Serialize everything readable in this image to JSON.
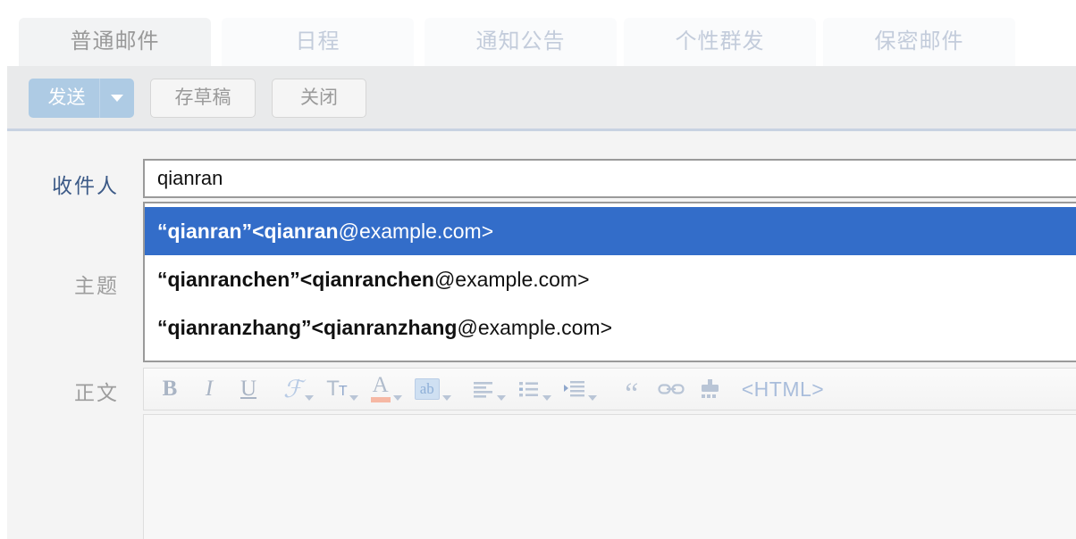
{
  "tabs": [
    {
      "label": "普通邮件",
      "active": true
    },
    {
      "label": "日程",
      "active": false
    },
    {
      "label": "通知公告",
      "active": false
    },
    {
      "label": "个性群发",
      "active": false
    },
    {
      "label": "保密邮件",
      "active": false
    }
  ],
  "actionbar": {
    "send_label": "发送",
    "send_caret": "chevron-down-icon",
    "save_draft_label": "存草稿",
    "close_label": "关闭"
  },
  "form": {
    "to_label": "收件人",
    "subject_label": "主题",
    "body_label": "正文",
    "to_value": "qianran",
    "to_placeholder": "",
    "subject_value": "",
    "subject_placeholder": ""
  },
  "autocomplete": {
    "items": [
      {
        "name": "“qianran”",
        "email_local": "<qianran",
        "email_domain": "@example.com>",
        "selected": true
      },
      {
        "name": "“qianranchen”",
        "email_local": "<qianranchen",
        "email_domain": "@example.com>",
        "selected": false
      },
      {
        "name": "“qianranzhang”",
        "email_local": "<qianranzhang",
        "email_domain": "@example.com>",
        "selected": false
      }
    ]
  },
  "editor_toolbar": {
    "buttons": [
      {
        "name": "bold-icon",
        "label": "B"
      },
      {
        "name": "italic-icon",
        "label": "I"
      },
      {
        "name": "underline-icon",
        "label": "U"
      },
      {
        "name": "font-family-icon",
        "label": "F"
      },
      {
        "name": "font-size-icon",
        "label": "T"
      },
      {
        "name": "font-color-icon",
        "label": "A"
      },
      {
        "name": "highlight-color-icon",
        "label": "ab"
      },
      {
        "name": "align-icon",
        "label": "align"
      },
      {
        "name": "bullet-list-icon",
        "label": "list"
      },
      {
        "name": "indent-icon",
        "label": "indent"
      },
      {
        "name": "blockquote-icon",
        "label": "“"
      },
      {
        "name": "insert-link-icon",
        "label": "link"
      },
      {
        "name": "clear-format-icon",
        "label": "eraser"
      },
      {
        "name": "html-source-icon",
        "label": "<HTML>"
      }
    ],
    "html_label": "<HTML>",
    "quote_label": "“"
  },
  "colors": {
    "accent_highlight": "#336dc9",
    "send_button": "#aecbe4",
    "tab_inactive_text": "#c3ccdb",
    "tab_active_text": "#999999",
    "to_label_text": "#3c5a87",
    "toolbar_band": "#e9eaeb"
  }
}
